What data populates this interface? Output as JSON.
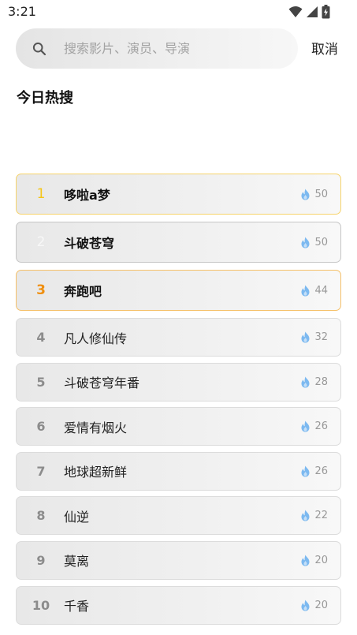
{
  "status_bar": {
    "time": "3:21",
    "icons": [
      "wifi-icon",
      "signal-icon",
      "battery-icon"
    ]
  },
  "search": {
    "placeholder": "搜索影片、演员、导演",
    "value": "",
    "cancel_label": "取消"
  },
  "section": {
    "title": "今日热搜"
  },
  "colors": {
    "rank1": "#f5c518",
    "rank2": "#f7f7f7",
    "rank3": "#ef8f10",
    "flame": "#7cb9f0"
  },
  "hot_list": [
    {
      "rank": "1",
      "title": "哆啦a梦",
      "heat": "50"
    },
    {
      "rank": "2",
      "title": "斗破苍穹",
      "heat": "50"
    },
    {
      "rank": "3",
      "title": "奔跑吧",
      "heat": "44"
    },
    {
      "rank": "4",
      "title": "凡人修仙传",
      "heat": "32"
    },
    {
      "rank": "5",
      "title": "斗破苍穹年番",
      "heat": "28"
    },
    {
      "rank": "6",
      "title": "爱情有烟火",
      "heat": "26"
    },
    {
      "rank": "7",
      "title": "地球超新鲜",
      "heat": "26"
    },
    {
      "rank": "8",
      "title": "仙逆",
      "heat": "22"
    },
    {
      "rank": "9",
      "title": "莫离",
      "heat": "20"
    },
    {
      "rank": "10",
      "title": "千香",
      "heat": "20"
    }
  ]
}
